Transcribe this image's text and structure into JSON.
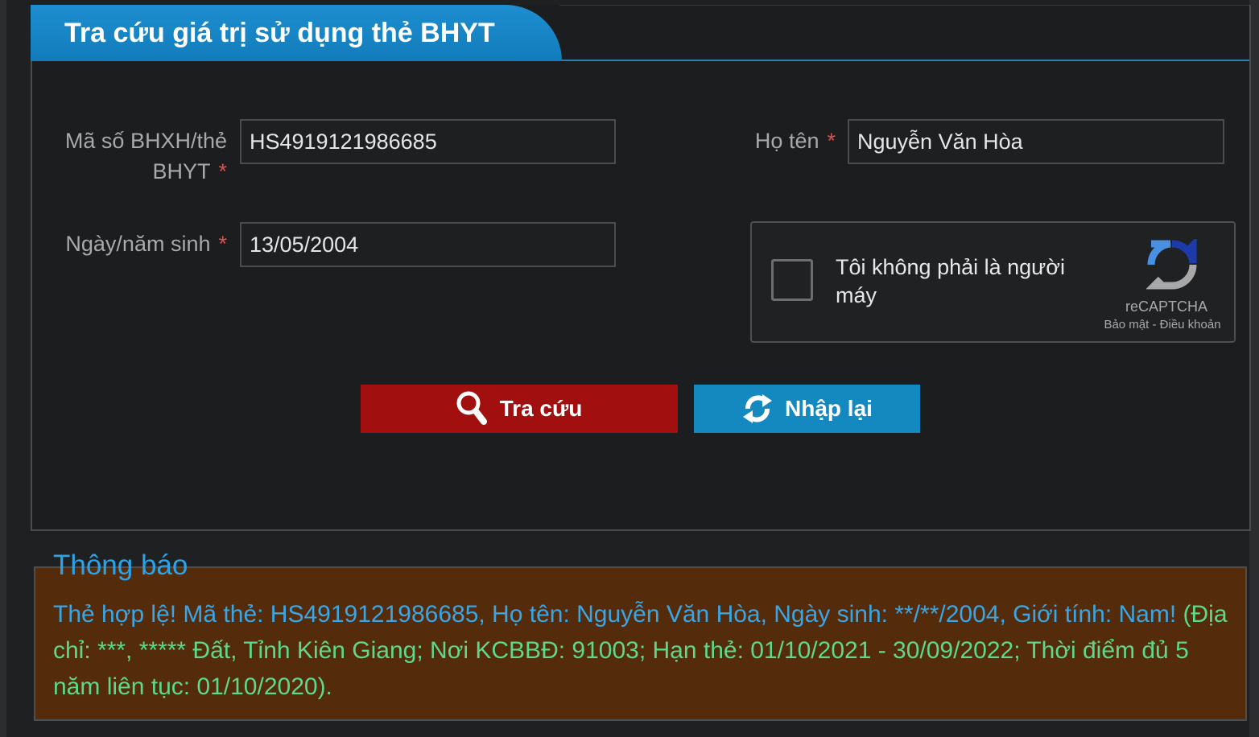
{
  "panel": {
    "title": "Tra cứu giá trị sử dụng thẻ BHYT"
  },
  "form": {
    "card_id": {
      "label_line1": "Mã số BHXH/thẻ",
      "label_line2": "BHYT",
      "required_mark": "*",
      "value": "HS4919121986685"
    },
    "full_name": {
      "label": "Họ tên",
      "required_mark": "*",
      "value": "Nguyễn Văn Hòa"
    },
    "birth_date": {
      "label": "Ngày/năm sinh",
      "required_mark": "*",
      "value": "13/05/2004"
    }
  },
  "recaptcha": {
    "text": "Tôi không phải là người máy",
    "brand": "reCAPTCHA",
    "privacy": "Bảo mật",
    "separator": "-",
    "terms": "Điều khoản"
  },
  "buttons": {
    "search_label": "Tra cứu",
    "reset_label": "Nhập lại"
  },
  "notice": {
    "title": "Thông báo",
    "message_blue": "Thẻ hợp lệ! Mã thẻ: HS4919121986685, Họ tên: Nguyễn Văn Hòa, Ngày sinh: **/**/2004, Giới tính: Nam!",
    "message_green": "(Địa chỉ: ***, ***** Đất, Tỉnh Kiên Giang; Nơi KCBBĐ: 91003; Hạn thẻ: 01/10/2021 - 30/09/2022; Thời điểm đủ 5 năm liên tục: 01/10/2020)."
  },
  "colors": {
    "title_tab": "#1589c9",
    "search_button": "#a20f0f",
    "reset_button": "#1489bf",
    "notice_background": "#542b0b",
    "notice_blue_text": "#3aa6e6",
    "notice_green_text": "#5ed88a",
    "required_mark": "#d9534f"
  },
  "icons": {
    "search_button_icon": "magnifier-icon",
    "reset_button_icon": "refresh-icon",
    "recaptcha_logo": "recaptcha-logo-icon"
  }
}
